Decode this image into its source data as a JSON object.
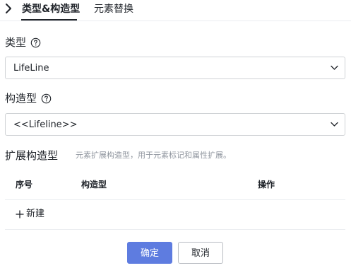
{
  "tabs": {
    "active_label": "类型&构造型",
    "replace_label": "元素替换"
  },
  "type_field": {
    "label": "类型",
    "value": "LifeLine"
  },
  "stereotype_field": {
    "label": "构造型",
    "value": "<<Lifeline>>"
  },
  "extension": {
    "title": "扩展构造型",
    "description": "元素扩展构造型，用于元素标记和属性扩展。",
    "columns": [
      "序号",
      "构造型",
      "操作"
    ],
    "add_label": "新建"
  },
  "actions": {
    "confirm_label": "确定",
    "cancel_label": "取消"
  },
  "colors": {
    "primary": "#5e7ce0",
    "border": "#d0d3d6",
    "muted_text": "#8f959e"
  },
  "icons": [
    "chevron-left-icon",
    "help-icon",
    "chevron-down-icon",
    "plus-icon"
  ]
}
